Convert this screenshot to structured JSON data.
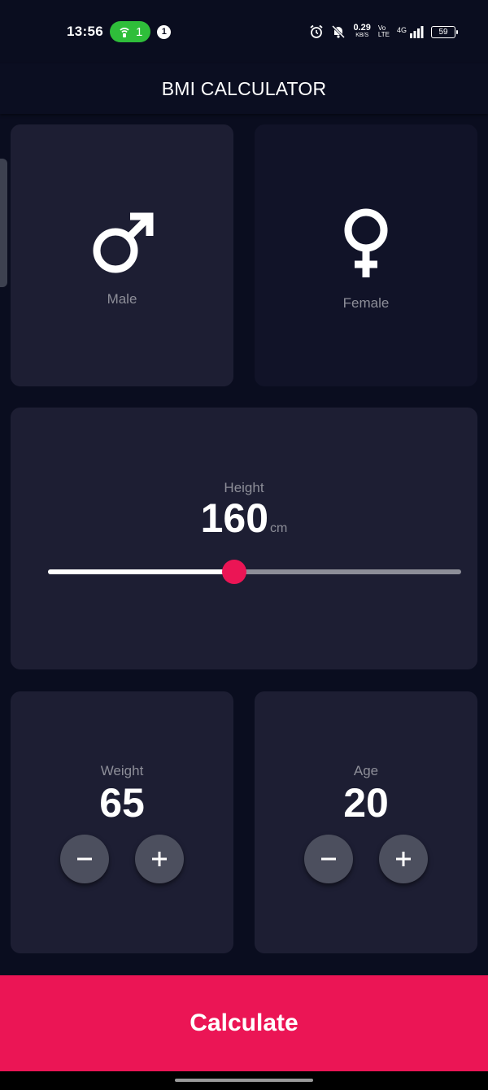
{
  "status_bar": {
    "time": "13:56",
    "hotspot_count": "1",
    "notification_count": "1",
    "net_speed_value": "0.29",
    "net_speed_unit": "KB/S",
    "volte_top": "Vo",
    "volte_bottom": "LTE",
    "signal_label": "4G",
    "battery": "59"
  },
  "app_bar": {
    "title": "BMI CALCULATOR"
  },
  "gender": {
    "male_label": "Male",
    "female_label": "Female",
    "selected": "none"
  },
  "height": {
    "label": "Height",
    "value": "160",
    "unit": "cm",
    "slider_fraction": 0.45
  },
  "weight": {
    "label": "Weight",
    "value": "65"
  },
  "age": {
    "label": "Age",
    "value": "20"
  },
  "calculate": {
    "label": "Calculate"
  },
  "colors": {
    "background": "#0a0d1f",
    "card_active": "#1d1e33",
    "card_inactive": "#111328",
    "accent": "#eb1555",
    "round_button": "#4c4f5e",
    "muted_text": "#8d8e98"
  }
}
